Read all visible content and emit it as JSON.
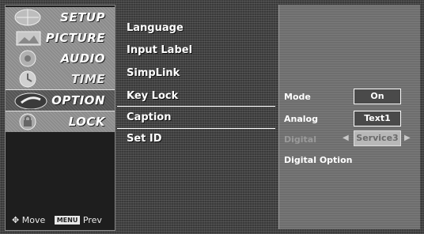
{
  "categories": [
    {
      "label": "SETUP",
      "icon": "globe-icon",
      "active": false
    },
    {
      "label": "PICTURE",
      "icon": "picture-icon",
      "active": false
    },
    {
      "label": "AUDIO",
      "icon": "speaker-icon",
      "active": false
    },
    {
      "label": "TIME",
      "icon": "clock-icon",
      "active": false
    },
    {
      "label": "OPTION",
      "icon": "option-tag-icon",
      "active": true
    },
    {
      "label": "LOCK",
      "icon": "lock-icon",
      "active": false
    }
  ],
  "footer": {
    "move_label": "Move",
    "prev_key": "MENU",
    "prev_label": "Prev"
  },
  "menu": {
    "items": [
      "Language",
      "Input Label",
      "SimpLink",
      "Key Lock",
      "Caption",
      "Set ID"
    ],
    "selected": "Caption"
  },
  "caption_panel": {
    "mode_label": "Mode",
    "mode_value": "On",
    "analog_label": "Analog",
    "analog_value": "Text1",
    "digital_label": "Digital",
    "digital_value": "Service3",
    "digital_option_label": "Digital Option"
  }
}
